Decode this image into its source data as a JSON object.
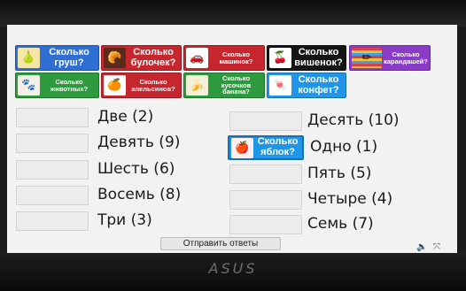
{
  "colors": {
    "blue": "#2f6fd3",
    "red": "#c6262e",
    "black": "#141414",
    "purple": "#8a3cc9",
    "green": "#2e9a3e",
    "cyan": "#2196e8"
  },
  "cards_row1": [
    {
      "label": "Сколько груш?",
      "icon": "pears-icon",
      "glyph": "🍐",
      "color": "blue"
    },
    {
      "label": "Сколько булочек?",
      "icon": "buns-icon",
      "glyph": "🥐",
      "color": "red"
    },
    {
      "label": "Сколько машинок?",
      "icon": "cars-icon",
      "glyph": "🚗",
      "color": "red"
    },
    {
      "label": "Сколько вишенок?",
      "icon": "cherries-icon",
      "glyph": "🍒",
      "color": "black"
    },
    {
      "label": "Сколько карандашей?",
      "icon": "pencils-icon",
      "glyph": "✏",
      "color": "purple"
    }
  ],
  "cards_row2": [
    {
      "label": "Сколько животных?",
      "icon": "animals-icon",
      "glyph": "🐾",
      "color": "green"
    },
    {
      "label": "Сколько апельсинов?",
      "icon": "oranges-icon",
      "glyph": "🍊",
      "color": "red"
    },
    {
      "label": "Сколько кусочков банана?",
      "icon": "banana-icon",
      "glyph": "🍌",
      "color": "green"
    },
    {
      "label": "Сколько конфет?",
      "icon": "candies-icon",
      "glyph": "🍬",
      "color": "cyan"
    }
  ],
  "placed_card": {
    "label": "Сколько яблок?",
    "icon": "apple-icon",
    "glyph": "🍎",
    "color": "cyan"
  },
  "answers_left": [
    "Две (2)",
    "Девять (9)",
    "Шесть (6)",
    "Восемь (8)",
    "Три (3)"
  ],
  "answers_right": [
    "Десять (10)",
    "Одно (1)",
    "Пять (5)",
    "Четыре (4)",
    "Семь (7)"
  ],
  "submit_label": "Отправить ответы",
  "brand": "ASUS"
}
